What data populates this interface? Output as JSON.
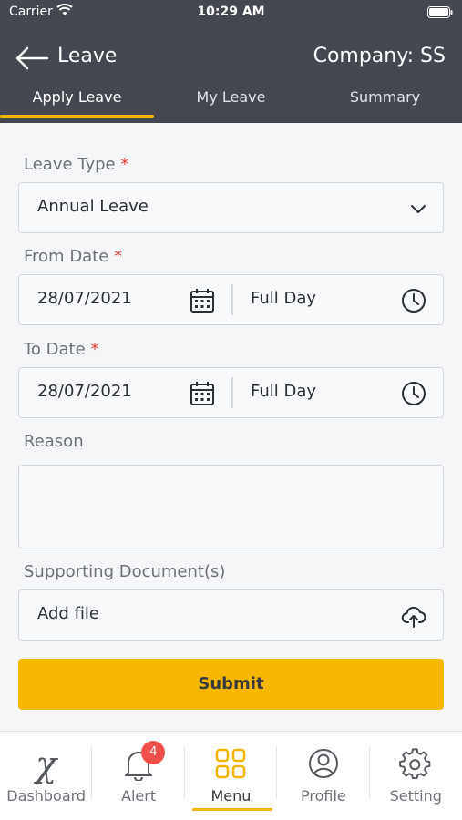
{
  "statusbar": {
    "carrier": "Carrier",
    "time": "10:29 AM"
  },
  "header": {
    "title": "Leave",
    "company": "Company: SS"
  },
  "tabs": [
    {
      "label": "Apply Leave",
      "active": true
    },
    {
      "label": "My Leave",
      "active": false
    },
    {
      "label": "Summary",
      "active": false
    }
  ],
  "form": {
    "leave_type": {
      "label": "Leave Type",
      "required_mark": "*",
      "value": "Annual Leave"
    },
    "from_date": {
      "label": "From Date",
      "required_mark": "*",
      "date": "28/07/2021",
      "day_type": "Full Day"
    },
    "to_date": {
      "label": "To Date",
      "required_mark": "*",
      "date": "28/07/2021",
      "day_type": "Full Day"
    },
    "reason": {
      "label": "Reason",
      "value": ""
    },
    "documents": {
      "label": "Supporting Document(s)",
      "button": "Add file"
    },
    "submit": "Submit"
  },
  "bottom_nav": [
    {
      "label": "Dashboard",
      "icon": "dashboard-x-icon"
    },
    {
      "label": "Alert",
      "icon": "bell-icon",
      "badge": "4"
    },
    {
      "label": "Menu",
      "icon": "grid-icon",
      "active": true
    },
    {
      "label": "Profile",
      "icon": "profile-icon"
    },
    {
      "label": "Setting",
      "icon": "gear-icon"
    }
  ],
  "colors": {
    "header": "#44474F",
    "accent": "#F9B800",
    "required": "#E53935",
    "badge": "#F0504B"
  }
}
